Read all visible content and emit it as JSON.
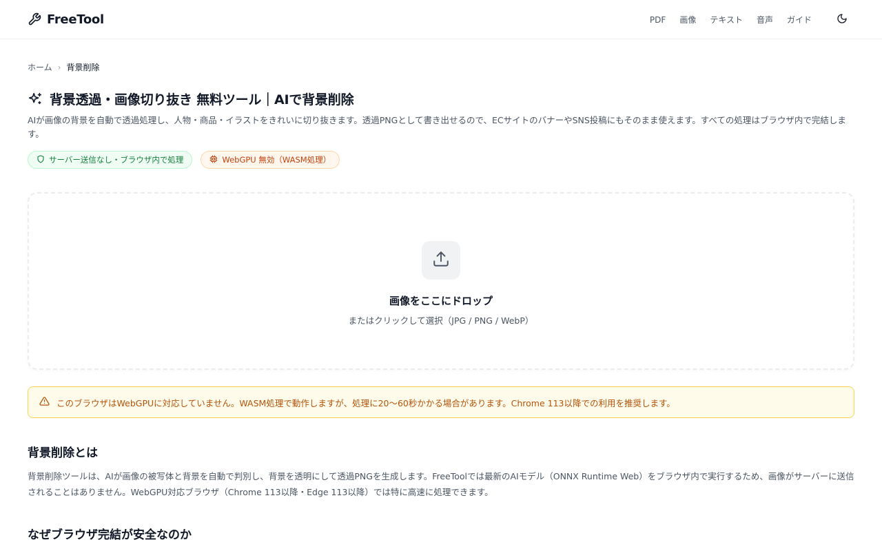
{
  "header": {
    "brand": "FreeTool",
    "nav": [
      "PDF",
      "画像",
      "テキスト",
      "音声",
      "ガイド"
    ]
  },
  "breadcrumb": {
    "home": "ホーム",
    "separator": "›",
    "current": "背景削除"
  },
  "page": {
    "title": "背景透過・画像切り抜き 無料ツール｜AIで背景削除",
    "description": "AIが画像の背景を自動で透過処理し、人物・商品・イラストをきれいに切り抜きます。透過PNGとして書き出せるので、ECサイトのバナーやSNS投稿にもそのまま使えます。すべての処理はブラウザ内で完結します。",
    "badges": {
      "privacy": "サーバー送信なし・ブラウザ内で処理",
      "webgpu": "WebGPU 無効（WASM処理）"
    }
  },
  "dropzone": {
    "title": "画像をここにドロップ",
    "subtitle": "またはクリックして選択（JPG / PNG / WebP）"
  },
  "warning": {
    "text": "このブラウザはWebGPUに対応していません。WASM処理で動作しますが、処理に20〜60秒かかる場合があります。Chrome 113以降での利用を推奨します。"
  },
  "sections": [
    {
      "heading": "背景削除とは",
      "body": "背景削除ツールは、AIが画像の被写体と背景を自動で判別し、背景を透明にして透過PNGを生成します。FreeToolでは最新のAIモデル（ONNX Runtime Web）をブラウザ内で実行するため、画像がサーバーに送信されることはありません。WebGPU対応ブラウザ（Chrome 113以降・Edge 113以降）では特に高速に処理できます。"
    },
    {
      "heading": "なぜブラウザ完結が安全なのか"
    }
  ],
  "colors": {
    "privacy_badge": "#15803d",
    "webgpu_badge": "#c2410c",
    "warning": "#b45309",
    "warning_bg": "#fffbeb"
  },
  "icons": {
    "logo": "wrench-icon",
    "theme": "moon-icon",
    "title": "sparkles-icon",
    "privacy": "shield-icon",
    "webgpu": "chip-icon",
    "upload": "upload-icon",
    "warning": "warning-triangle-icon"
  }
}
